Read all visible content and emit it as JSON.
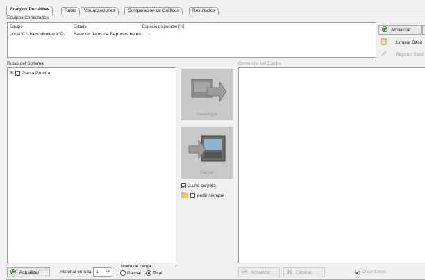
{
  "tabs": [
    "Equipos Portátiles",
    "Rutas",
    "Visualizaciones",
    "Comparación de Gráficos",
    "Resultados"
  ],
  "connected": {
    "group_label": "Equipos Conectados",
    "columns": [
      "Equipo",
      "Estado",
      "Espacio disponible [%]"
    ],
    "rows": [
      [
        "Local:C:\\Users\\dboltezar\\D...",
        "Base de datos de Reportes no en...",
        "-"
      ]
    ]
  },
  "right_buttons": {
    "update": "Actualizar",
    "clean": "Limpiar Base",
    "repair": "Reparar Base"
  },
  "routes": {
    "group_label": "Rutas del Sistema",
    "tree_expander": "⊞",
    "tree_item": "Planta Prueba",
    "update": "Actualizar",
    "history_label": "Historial en ruta",
    "history_value": "1",
    "load_mode_label": "Modo de carga",
    "mode_partial": "Parcial",
    "mode_total": "Total"
  },
  "middle": {
    "download": "Descargar",
    "upload": "Cargar",
    "to_folder": "a una carpeta",
    "always_ask": "pedir siempre"
  },
  "device": {
    "group_label": "Contenido del Equipo",
    "update": "Actualizar",
    "delete": "Eliminar",
    "create_excel": "Crear Excel"
  },
  "colors": {
    "accent_green": "#3a8a2a",
    "panel_border": "#9c9c9c",
    "disabled_text": "#a0a0a0"
  }
}
